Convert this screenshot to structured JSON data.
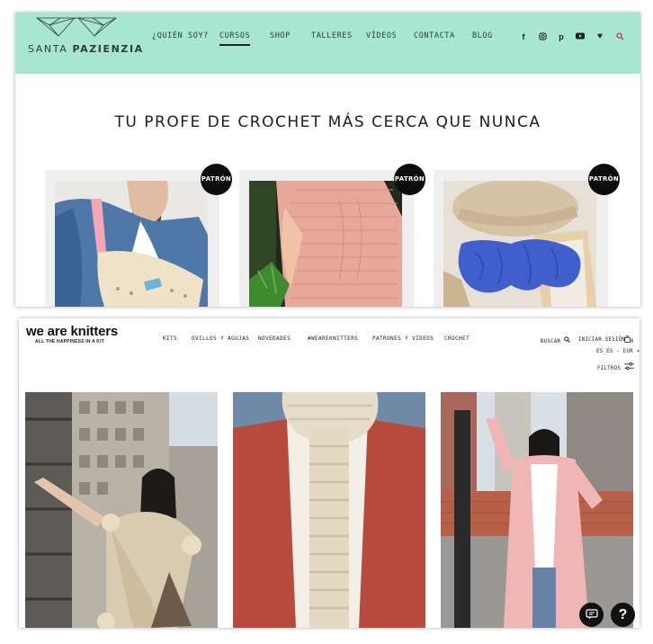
{
  "santa_pazienzia": {
    "logo": {
      "text_light": "SANTA ",
      "text_bold": "PAZIENZIA"
    },
    "nav": [
      {
        "label": "¿QUIÉN SOY?"
      },
      {
        "label": "CURSOS",
        "active": true
      },
      {
        "label": "SHOP"
      },
      {
        "label": "TALLERES"
      },
      {
        "label": "VÍDEOS"
      },
      {
        "label": "CONTACTA"
      },
      {
        "label": "BLOG"
      }
    ],
    "social_icons": [
      "facebook-icon",
      "instagram-icon",
      "pinterest-icon",
      "youtube-icon",
      "heart-icon",
      "search-icon"
    ],
    "headline": "TU PROFE DE CROCHET MÁS CERCA QUE NUNCA",
    "cards": [
      {
        "badge": "PATRÓN",
        "image": "woman in denim vest with crochet bag"
      },
      {
        "badge": "PATRÓN",
        "image": "pink crochet top"
      },
      {
        "badge": "PATRÓN",
        "image": "blue crochet headband with hat and espadrilles"
      }
    ],
    "colors": {
      "header_bg": "#a8e6d2",
      "badge_bg": "#0c0c0c"
    }
  },
  "we_are_knitters": {
    "brand": "we are knitters",
    "tagline": "ALL THE HAPPINESS IN A KIT",
    "nav": [
      {
        "label": "KITS"
      },
      {
        "label": "OVILLOS Y AGUJAS"
      },
      {
        "label": "NOVEDADES"
      },
      {
        "label": "#WEAREKNITTERS"
      },
      {
        "label": "PATRONES Y VÍDEOS"
      },
      {
        "label": "CROCHET"
      }
    ],
    "utility": {
      "search": "BUSCAR",
      "login": "INICIAR SESIÓN",
      "cart_count": "0",
      "locale": "ES_ES - EUR",
      "filters": "FILTROS"
    },
    "products": [
      {
        "image": "woman with chunky knit shawl on fire escape"
      },
      {
        "image": "chunky cream knit scarf over red coat"
      },
      {
        "image": "woman in long pink knit cardigan on rooftop"
      }
    ],
    "floating_icons": [
      "chat-icon",
      "help-icon"
    ]
  }
}
